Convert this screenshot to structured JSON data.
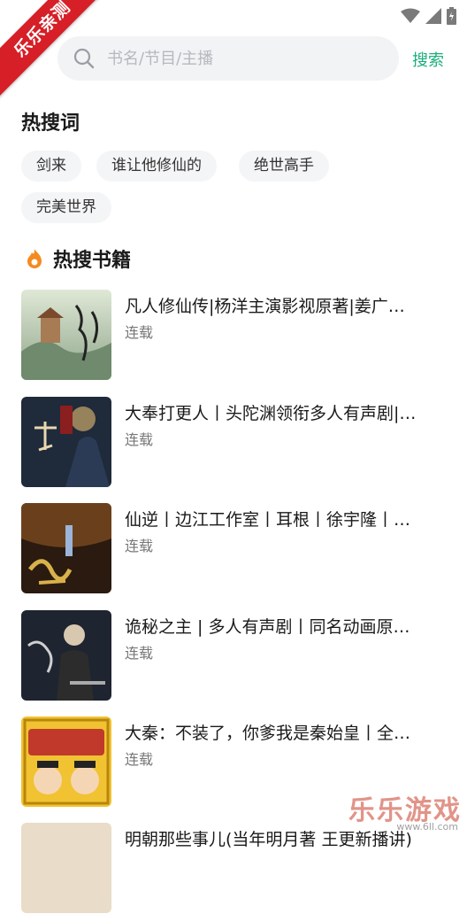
{
  "ribbon": {
    "text": "乐乐亲测"
  },
  "search": {
    "placeholder": "书名/节目/主播",
    "button_label": "搜索"
  },
  "hot_words": {
    "title": "热搜词",
    "items": [
      "剑来",
      "谁让他修仙的",
      "绝世高手",
      "完美世界"
    ]
  },
  "hot_books": {
    "title": "热搜书籍",
    "items": [
      {
        "title": "凡人修仙传|杨洋主演影视原著|姜广…",
        "status": "连载"
      },
      {
        "title": "大奉打更人丨头陀渊领衔多人有声剧|…",
        "status": "连载"
      },
      {
        "title": "仙逆丨边江工作室丨耳根丨徐宇隆丨…",
        "status": "连载"
      },
      {
        "title": "诡秘之主 | 多人有声剧丨同名动画原…",
        "status": "连载"
      },
      {
        "title": "大秦：不装了，你爹我是秦始皇丨全…",
        "status": "连载"
      },
      {
        "title": "明朝那些事儿(当年明月著 王更新播讲)",
        "status": ""
      }
    ]
  },
  "watermark": {
    "main": "乐乐游戏",
    "sub": "www.6ll.com"
  },
  "colors": {
    "accent": "#1bae7a",
    "ribbon": "#d61f27"
  }
}
